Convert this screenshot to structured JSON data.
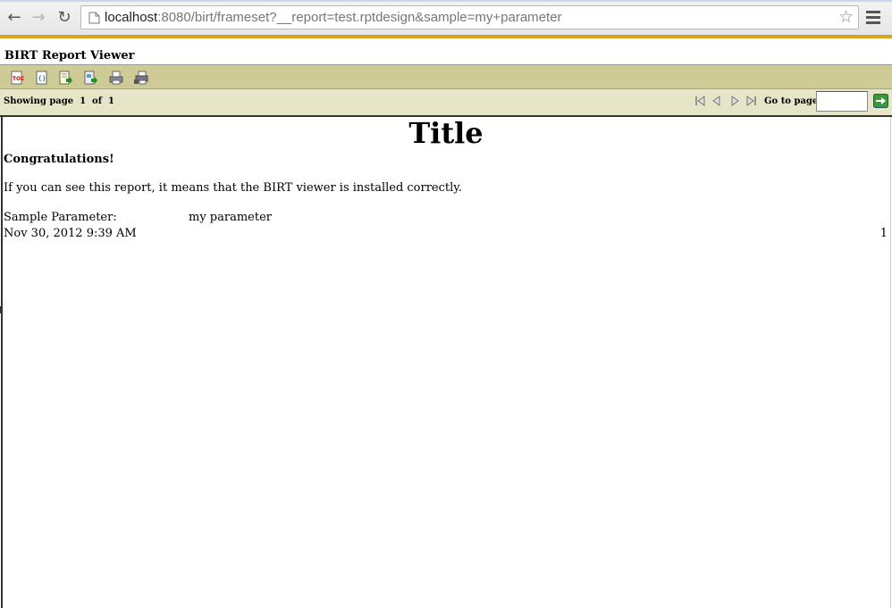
{
  "browser": {
    "url_host": "localhost",
    "url_rest": ":8080/birt/frameset?__report=test.rptdesign&sample=my+parameter",
    "icons": [
      "back-icon",
      "forward-icon",
      "reload-icon",
      "page-icon",
      "star-icon",
      "menu-icon"
    ],
    "accent_color": "#d8a21e"
  },
  "viewer": {
    "title": "BIRT Report Viewer",
    "toolbar_icons": [
      "toc-icon",
      "parameters-icon",
      "export-data-icon",
      "export-report-icon",
      "print-icon",
      "print-server-icon"
    ],
    "toolbar_color": "#cfcb97",
    "navbar_color": "#e7e5c8"
  },
  "navigation": {
    "showing_label": "Showing page",
    "current_page": "1",
    "of_label": "of",
    "total_pages": "1",
    "goto_label": "Go to page:",
    "goto_value": "",
    "nav_icons": [
      "first-page-icon",
      "previous-page-icon",
      "next-page-icon",
      "last-page-icon",
      "go-arrow-icon"
    ]
  },
  "report": {
    "title": "Title",
    "congrats": "Congratulations!",
    "message": "If you can see this report, it means that the BIRT viewer is installed correctly.",
    "param_label": "Sample Parameter:",
    "param_value": "my parameter",
    "date": "Nov 30, 2012 9:39 AM",
    "page_number": "1"
  }
}
